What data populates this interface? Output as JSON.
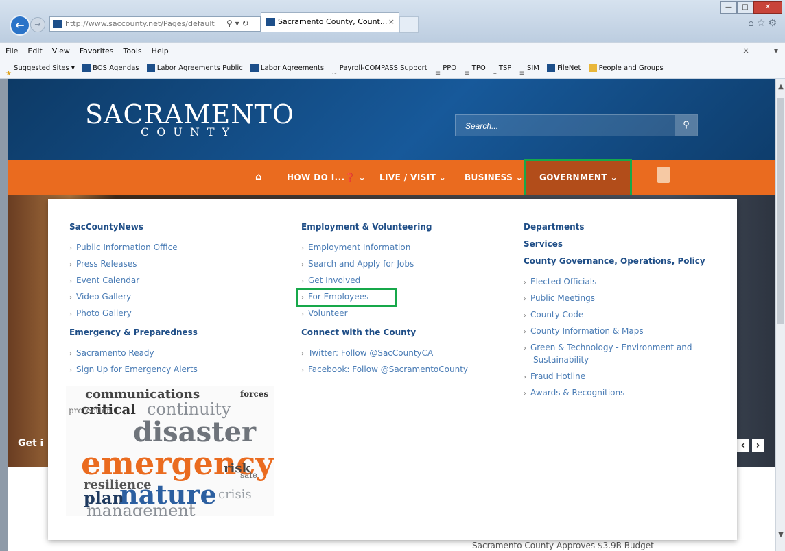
{
  "browser": {
    "address_url": "http://www.saccounty.net/Pages/default",
    "address_host_bold": "saccounty.net",
    "address_tools": "⚲ ▾ ↻",
    "tab_title": "Sacramento County, Count...",
    "tab_close": "×",
    "window_min": "—",
    "window_max": "□",
    "window_close": "✕",
    "right_icons": "⌂☆⚙",
    "back_glyph": "←",
    "forward_glyph": "→",
    "menu_close": "×",
    "menu_ext": "▾"
  },
  "menubar": {
    "items": [
      "File",
      "Edit",
      "View",
      "Favorites",
      "Tools",
      "Help"
    ]
  },
  "favorites_bar": {
    "items": [
      {
        "label": "Suggested Sites ▾",
        "icon": "star-icon"
      },
      {
        "label": "BOS Agendas",
        "icon": "page-icon"
      },
      {
        "label": "Labor Agreements Public",
        "icon": "page-icon"
      },
      {
        "label": "Labor Agreements",
        "icon": "page-icon"
      },
      {
        "label": "Payroll-COMPASS Support",
        "icon": "link-icon"
      },
      {
        "label": "PPO",
        "icon": "link-icon"
      },
      {
        "label": "TPO",
        "icon": "link-icon"
      },
      {
        "label": "TSP",
        "icon": "link-icon"
      },
      {
        "label": "SIM",
        "icon": "link-icon"
      },
      {
        "label": "FileNet",
        "icon": "page-icon"
      },
      {
        "label": "People and Groups",
        "icon": "folder-icon"
      }
    ]
  },
  "site": {
    "logo_main": "SACRAMENTO",
    "logo_sub": "COUNTY",
    "search_placeholder": "Search...",
    "search_glyph": "⚲"
  },
  "nav": {
    "home_glyph": "⌂",
    "how_do_i": "HOW DO I...❓ ⌄",
    "live_visit": "LIVE / VISIT ⌄",
    "business": "BUSINESS ⌄",
    "government": "GOVERNMENT ⌄"
  },
  "mega": {
    "col1": {
      "heading1": "SacCountyNews",
      "links1": [
        "Public Information Office",
        "Press Releases",
        "Event Calendar",
        "Video Gallery",
        "Photo Gallery"
      ],
      "heading2": "Emergency & Preparedness",
      "links2": [
        "Sacramento Ready",
        "Sign Up for Emergency Alerts"
      ]
    },
    "col2": {
      "heading1": "Employment & Volunteering",
      "links1": [
        "Employment Information",
        "Search and Apply for Jobs",
        "Get Involved",
        "For Employees",
        "Volunteer"
      ],
      "heading2": "Connect with the County",
      "links2": [
        "Twitter: Follow @SacCountyCA",
        "Facebook: Follow @SacramentoCounty"
      ]
    },
    "col3": {
      "heading1": "Departments",
      "heading2": "Services",
      "heading3": "County Governance, Operations, Policy",
      "links": [
        "Elected Officials",
        "Public Meetings",
        "County Code",
        "County Information & Maps",
        "Green & Technology - Environment and",
        "Sustainability",
        "Fraud Hotline",
        "Awards & Recognitions"
      ]
    },
    "chevron": "›",
    "word_cloud": [
      "communications",
      "continuity",
      "critical",
      "disaster",
      "emergency",
      "resilience",
      "plan",
      "nature",
      "crisis",
      "management",
      "protection",
      "risk",
      "safe",
      "forces"
    ]
  },
  "hero": {
    "text": "Get i",
    "prev": "‹",
    "next": "›",
    "headline": "Sacramento County Approves $3.9B Budget"
  },
  "colors": {
    "nav_orange": "#ea6b1f",
    "gov_active": "#b24d1a",
    "highlight_green": "#17a84a",
    "link_blue": "#4a7cb5",
    "heading_blue": "#1f4e87"
  }
}
